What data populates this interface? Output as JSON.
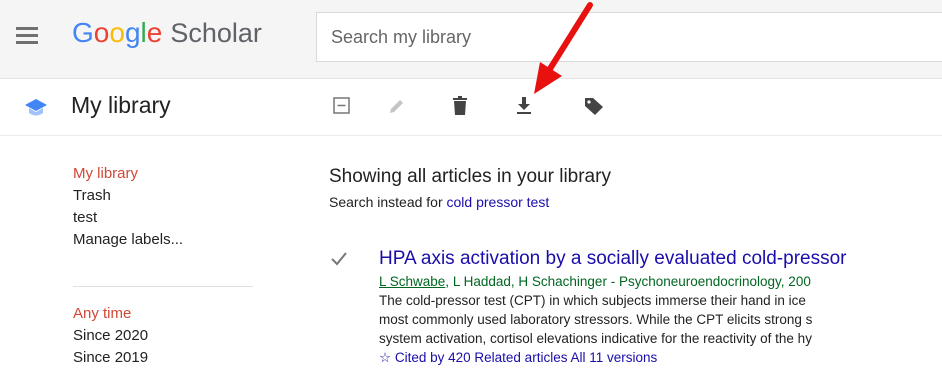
{
  "header": {
    "logo_google": [
      "G",
      "o",
      "o",
      "g",
      "l",
      "e"
    ],
    "logo_colors": [
      "#4285f4",
      "#ea4335",
      "#fbbc05",
      "#4285f4",
      "#34a853",
      "#ea4335"
    ],
    "logo_scholar": "Scholar",
    "search_placeholder": "Search my library"
  },
  "subheader": {
    "title": "My library",
    "tools": [
      "select-all-icon",
      "edit-icon",
      "delete-icon",
      "export-icon",
      "label-icon"
    ]
  },
  "sidebar": {
    "items": [
      {
        "label": "My library",
        "active": true
      },
      {
        "label": "Trash"
      },
      {
        "label": "test"
      },
      {
        "label": "Manage labels..."
      }
    ],
    "time_filters": [
      {
        "label": "Any time",
        "active": true
      },
      {
        "label": "Since 2020"
      },
      {
        "label": "Since 2019"
      }
    ]
  },
  "main": {
    "heading": "Showing all articles in your library",
    "instead_prefix": "Search instead for ",
    "instead_query": "cold pressor test"
  },
  "result": {
    "title": "HPA axis activation by a socially evaluated cold-pressor",
    "authors": [
      "L Schwabe",
      "L Haddad",
      "H Schachinger"
    ],
    "author_sep": ", ",
    "source": " - Psychoneuroendocrinology, 200",
    "snippet": [
      "The cold-pressor test (CPT) in which subjects immerse their hand in ice",
      "most commonly used laboratory stressors. While the CPT elicits strong s",
      "system activation, cortisol elevations indicative for the reactivity of the hy"
    ],
    "links": "☆ Cited by 420  Related articles  All 11 versions"
  },
  "colors": {
    "accent_red": "#d14836",
    "link_blue": "#1a0dab",
    "author_green": "#006621",
    "annotation_arrow": "#e8110f"
  }
}
